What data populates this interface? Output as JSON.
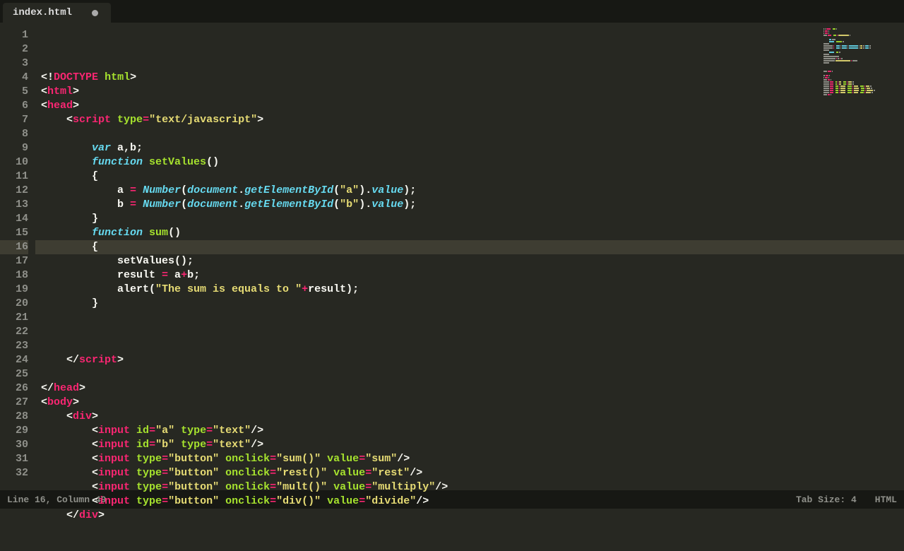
{
  "tab": {
    "title": "index.html",
    "dirty": true
  },
  "status": {
    "pos": "Line 16, Column 49",
    "tab": "Tab Size: 4",
    "lang": "HTML"
  },
  "gutter_start": 1,
  "gutter_end": 32,
  "active_line": 16,
  "code": [
    [
      [
        "p",
        "<"
      ],
      [
        "p",
        "!"
      ],
      [
        "t",
        "DOCTYPE"
      ],
      [
        "p",
        " "
      ],
      [
        "fn",
        "html"
      ],
      [
        "p",
        ">"
      ]
    ],
    [
      [
        "p",
        "<"
      ],
      [
        "t",
        "html"
      ],
      [
        "p",
        ">"
      ]
    ],
    [
      [
        "p",
        "<"
      ],
      [
        "t",
        "head"
      ],
      [
        "p",
        ">"
      ]
    ],
    [
      [
        "p",
        "    <"
      ],
      [
        "t",
        "script"
      ],
      [
        "p",
        " "
      ],
      [
        "fn",
        "type"
      ],
      [
        "t",
        "="
      ],
      [
        "st",
        "\"text/javascript\""
      ],
      [
        "p",
        ">"
      ]
    ],
    [
      [
        "p",
        ""
      ]
    ],
    [
      [
        "p",
        "        "
      ],
      [
        "kw",
        "var"
      ],
      [
        "p",
        " a,b;"
      ]
    ],
    [
      [
        "p",
        "        "
      ],
      [
        "kw",
        "function"
      ],
      [
        "p",
        " "
      ],
      [
        "fn",
        "setValues"
      ],
      [
        "p",
        "()"
      ]
    ],
    [
      [
        "p",
        "        {"
      ]
    ],
    [
      [
        "p",
        "            a "
      ],
      [
        "t",
        "="
      ],
      [
        "p",
        " "
      ],
      [
        "kw",
        "Number"
      ],
      [
        "p",
        "("
      ],
      [
        "kw",
        "document"
      ],
      [
        "p",
        "."
      ],
      [
        "kw",
        "getElementById"
      ],
      [
        "p",
        "("
      ],
      [
        "st",
        "\"a\""
      ],
      [
        "p",
        ")."
      ],
      [
        "kw",
        "value"
      ],
      [
        "p",
        ");"
      ]
    ],
    [
      [
        "p",
        "            b "
      ],
      [
        "t",
        "="
      ],
      [
        "p",
        " "
      ],
      [
        "kw",
        "Number"
      ],
      [
        "p",
        "("
      ],
      [
        "kw",
        "document"
      ],
      [
        "p",
        "."
      ],
      [
        "kw",
        "getElementById"
      ],
      [
        "p",
        "("
      ],
      [
        "st",
        "\"b\""
      ],
      [
        "p",
        ")."
      ],
      [
        "kw",
        "value"
      ],
      [
        "p",
        ");"
      ]
    ],
    [
      [
        "p",
        "        }"
      ]
    ],
    [
      [
        "p",
        "        "
      ],
      [
        "kw",
        "function"
      ],
      [
        "p",
        " "
      ],
      [
        "fn",
        "sum"
      ],
      [
        "p",
        "()"
      ]
    ],
    [
      [
        "p",
        "        {"
      ]
    ],
    [
      [
        "p",
        "            setValues();"
      ]
    ],
    [
      [
        "p",
        "            result "
      ],
      [
        "t",
        "="
      ],
      [
        "p",
        " a"
      ],
      [
        "t",
        "+"
      ],
      [
        "p",
        "b;"
      ]
    ],
    [
      [
        "p",
        "            alert("
      ],
      [
        "st",
        "\"The sum is equals to \""
      ],
      [
        "t",
        "+"
      ],
      [
        "p",
        "result);"
      ]
    ],
    [
      [
        "p",
        "        }"
      ]
    ],
    [
      [
        "p",
        ""
      ]
    ],
    [
      [
        "p",
        ""
      ]
    ],
    [
      [
        "p",
        ""
      ]
    ],
    [
      [
        "p",
        "    </"
      ],
      [
        "t",
        "script"
      ],
      [
        "p",
        ">"
      ]
    ],
    [
      [
        "p",
        ""
      ]
    ],
    [
      [
        "p",
        "</"
      ],
      [
        "t",
        "head"
      ],
      [
        "p",
        ">"
      ]
    ],
    [
      [
        "p",
        "<"
      ],
      [
        "t",
        "body"
      ],
      [
        "p",
        ">"
      ]
    ],
    [
      [
        "p",
        "    <"
      ],
      [
        "t",
        "div"
      ],
      [
        "p",
        ">"
      ]
    ],
    [
      [
        "p",
        "        <"
      ],
      [
        "t",
        "input"
      ],
      [
        "p",
        " "
      ],
      [
        "fn",
        "id"
      ],
      [
        "t",
        "="
      ],
      [
        "st",
        "\"a\""
      ],
      [
        "p",
        " "
      ],
      [
        "fn",
        "type"
      ],
      [
        "t",
        "="
      ],
      [
        "st",
        "\"text\""
      ],
      [
        "p",
        "/>"
      ]
    ],
    [
      [
        "p",
        "        <"
      ],
      [
        "t",
        "input"
      ],
      [
        "p",
        " "
      ],
      [
        "fn",
        "id"
      ],
      [
        "t",
        "="
      ],
      [
        "st",
        "\"b\""
      ],
      [
        "p",
        " "
      ],
      [
        "fn",
        "type"
      ],
      [
        "t",
        "="
      ],
      [
        "st",
        "\"text\""
      ],
      [
        "p",
        "/>"
      ]
    ],
    [
      [
        "p",
        "        <"
      ],
      [
        "t",
        "input"
      ],
      [
        "p",
        " "
      ],
      [
        "fn",
        "type"
      ],
      [
        "t",
        "="
      ],
      [
        "st",
        "\"button\""
      ],
      [
        "p",
        " "
      ],
      [
        "fn",
        "onclick"
      ],
      [
        "t",
        "="
      ],
      [
        "st",
        "\"sum()\""
      ],
      [
        "p",
        " "
      ],
      [
        "fn",
        "value"
      ],
      [
        "t",
        "="
      ],
      [
        "st",
        "\"sum\""
      ],
      [
        "p",
        "/>"
      ]
    ],
    [
      [
        "p",
        "        <"
      ],
      [
        "t",
        "input"
      ],
      [
        "p",
        " "
      ],
      [
        "fn",
        "type"
      ],
      [
        "t",
        "="
      ],
      [
        "st",
        "\"button\""
      ],
      [
        "p",
        " "
      ],
      [
        "fn",
        "onclick"
      ],
      [
        "t",
        "="
      ],
      [
        "st",
        "\"rest()\""
      ],
      [
        "p",
        " "
      ],
      [
        "fn",
        "value"
      ],
      [
        "t",
        "="
      ],
      [
        "st",
        "\"rest\""
      ],
      [
        "p",
        "/>"
      ]
    ],
    [
      [
        "p",
        "        <"
      ],
      [
        "t",
        "input"
      ],
      [
        "p",
        " "
      ],
      [
        "fn",
        "type"
      ],
      [
        "t",
        "="
      ],
      [
        "st",
        "\"button\""
      ],
      [
        "p",
        " "
      ],
      [
        "fn",
        "onclick"
      ],
      [
        "t",
        "="
      ],
      [
        "st",
        "\"mult()\""
      ],
      [
        "p",
        " "
      ],
      [
        "fn",
        "value"
      ],
      [
        "t",
        "="
      ],
      [
        "st",
        "\"multiply\""
      ],
      [
        "p",
        "/>"
      ]
    ],
    [
      [
        "p",
        "        <"
      ],
      [
        "t",
        "input"
      ],
      [
        "p",
        " "
      ],
      [
        "fn",
        "type"
      ],
      [
        "t",
        "="
      ],
      [
        "st",
        "\"button\""
      ],
      [
        "p",
        " "
      ],
      [
        "fn",
        "onclick"
      ],
      [
        "t",
        "="
      ],
      [
        "st",
        "\"div()\""
      ],
      [
        "p",
        " "
      ],
      [
        "fn",
        "value"
      ],
      [
        "t",
        "="
      ],
      [
        "st",
        "\"divide\""
      ],
      [
        "p",
        "/>"
      ]
    ],
    [
      [
        "p",
        "    </"
      ],
      [
        "t",
        "div"
      ],
      [
        "p",
        ">"
      ]
    ]
  ],
  "minimap_colors": {
    "p": "#9a9a92",
    "t": "#f92672",
    "kw": "#66d9ef",
    "fn": "#a6e22e",
    "st": "#e6db74"
  }
}
